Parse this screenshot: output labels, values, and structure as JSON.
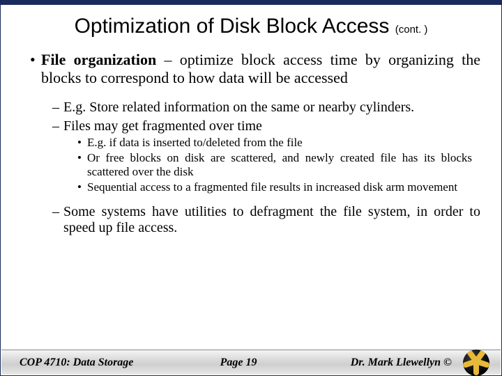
{
  "title": {
    "main": "Optimization of Disk Block Access ",
    "cont": "(cont. )"
  },
  "bullets": {
    "b1_strong": "File organization",
    "b1_rest": " – optimize block access time by organizing the blocks to correspond to how data will be accessed",
    "s1": "E.g.  Store related information on the same or nearby cylinders.",
    "s2": "Files may get ",
    "s2_frag": "fragmented",
    "s2_rest": " over time",
    "t1": "E.g. if data is inserted to/deleted from the file",
    "t2": "Or free blocks on disk are scattered, and newly created file has its blocks scattered over the disk",
    "t3": "Sequential access to a fragmented file results in increased disk arm movement",
    "s3": "Some systems have utilities to defragment the file system, in order to speed up file access."
  },
  "footer": {
    "course": "COP 4710: Data Storage",
    "page": "Page 19",
    "author": "Dr. Mark Llewellyn ©"
  }
}
